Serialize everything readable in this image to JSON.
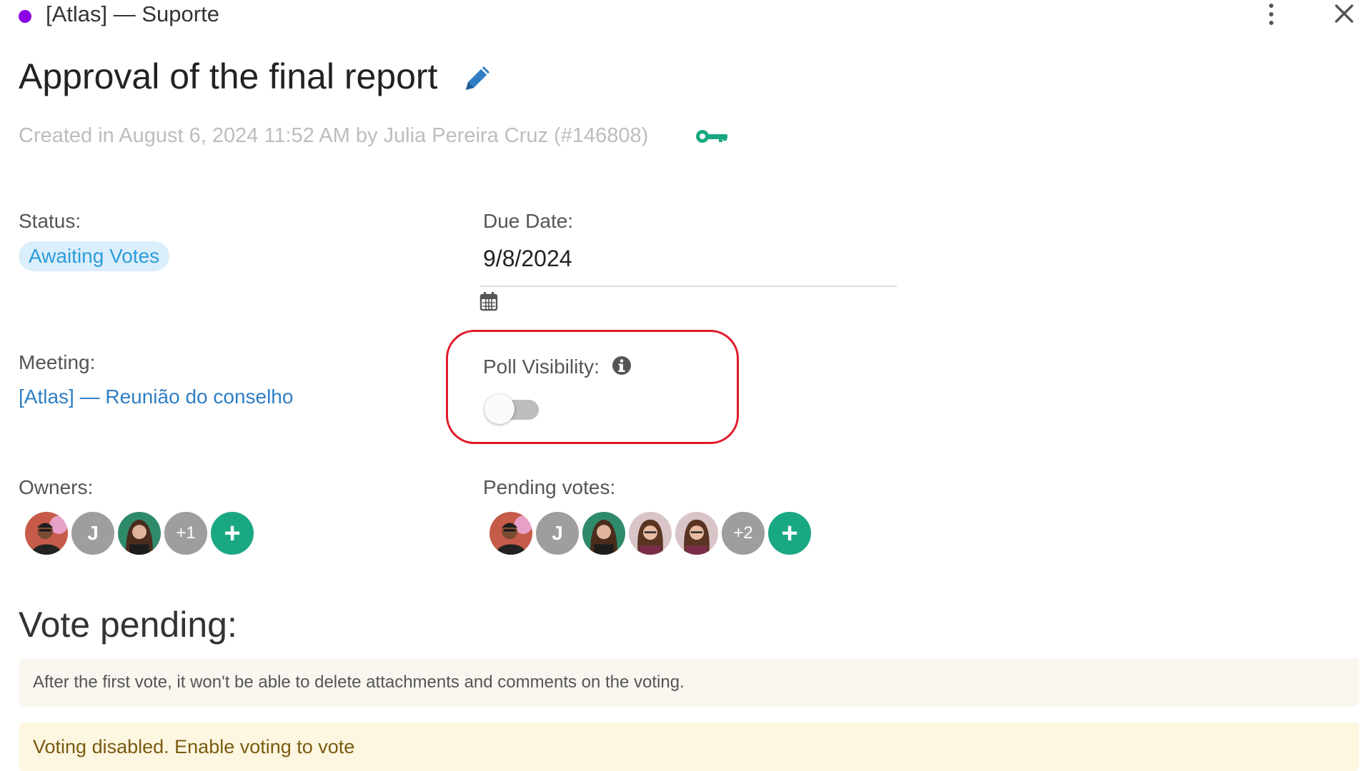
{
  "header": {
    "workspace_name": "[Atlas] — Suporte",
    "workspace_color": "#8a00e6",
    "more_icon": "kebab-vertical-icon",
    "close_icon": "close-icon"
  },
  "title": "Approval of the final report",
  "title_edit_icon": "pencil-icon",
  "created_text": "Created in August 6, 2024 11:52 AM by Julia Pereira Cruz (#146808)",
  "created_icon": "key-icon",
  "status": {
    "label": "Status:",
    "value": "Awaiting Votes",
    "badge_color": "#2d9cdb"
  },
  "due_date": {
    "label": "Due Date:",
    "value": "9/8/2024",
    "icon": "calendar-icon"
  },
  "meeting": {
    "label": "Meeting:",
    "value": "[Atlas] — Reunião do conselho"
  },
  "poll_visibility": {
    "label": "Poll Visibility:",
    "info_icon": "info-icon",
    "enabled": false
  },
  "owners": {
    "label": "Owners:",
    "initial": "J",
    "more": "+1",
    "add": "+"
  },
  "pending_votes": {
    "label": "Pending votes:",
    "initial": "J",
    "more": "+2",
    "add": "+"
  },
  "vote_section": {
    "heading": "Vote pending:",
    "notice": "After the first vote, it won't be able to delete attachments and comments on the voting.",
    "disabled_message": "Voting disabled. Enable voting to vote"
  },
  "colors": {
    "accent_green": "#1aa883",
    "highlight_red": "#e0192a",
    "link_blue": "#2f7ec4"
  }
}
